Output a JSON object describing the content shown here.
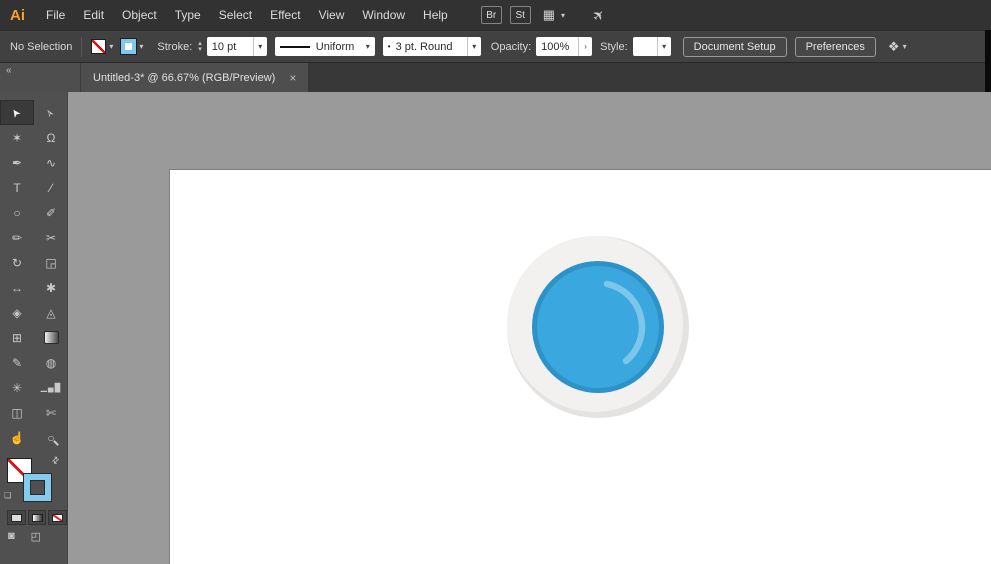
{
  "menubar": {
    "logo": "Ai",
    "items": [
      "File",
      "Edit",
      "Object",
      "Type",
      "Select",
      "Effect",
      "View",
      "Window",
      "Help"
    ],
    "bridge_badge": "Br",
    "stock_badge": "St"
  },
  "controlbar": {
    "selection_status": "No Selection",
    "stroke_label": "Stroke:",
    "stroke_weight": "10 pt",
    "width_profile": "Uniform",
    "brush_bullet": "•",
    "brush_name": "3 pt. Round",
    "opacity_label": "Opacity:",
    "opacity_value": "100%",
    "style_label": "Style:",
    "document_setup_button": "Document Setup",
    "preferences_button": "Preferences"
  },
  "tabbar": {
    "collapse_icon": "«",
    "active_tab_title": "Untitled-3* @ 66.67% (RGB/Preview)",
    "close_icon": "×"
  },
  "icons": {
    "chevron_down": "▾",
    "stepper_up": "▴",
    "stepper_down": "▾",
    "opacity_chevron": "›",
    "workspace_grid": "▦",
    "gpu_performance": "✈",
    "transform_widget": "❖",
    "swap_arrows": "⇄",
    "mini_swatches": "❏",
    "draw_mode_normal": "◙",
    "draw_mode_alt": "◰"
  },
  "tools": {
    "items": [
      {
        "name": "selection-tool",
        "glyph": "➤"
      },
      {
        "name": "direct-selection-tool",
        "glyph": "➢"
      },
      {
        "name": "magic-wand-tool",
        "glyph": "✶"
      },
      {
        "name": "lasso-tool",
        "glyph": "Ω"
      },
      {
        "name": "pen-tool",
        "glyph": "✒"
      },
      {
        "name": "curvature-tool",
        "glyph": "∿"
      },
      {
        "name": "type-tool",
        "glyph": "T"
      },
      {
        "name": "line-segment-tool",
        "glyph": "∕"
      },
      {
        "name": "ellipse-tool",
        "glyph": "○"
      },
      {
        "name": "paintbrush-tool",
        "glyph": "✐"
      },
      {
        "name": "pencil-tool",
        "glyph": "✏"
      },
      {
        "name": "scissors-tool",
        "glyph": "✂"
      },
      {
        "name": "rotate-tool",
        "glyph": "↻"
      },
      {
        "name": "scale-tool",
        "glyph": "◲"
      },
      {
        "name": "width-tool",
        "glyph": "↔"
      },
      {
        "name": "free-transform-tool",
        "glyph": "✱"
      },
      {
        "name": "shape-builder-tool",
        "glyph": "◈"
      },
      {
        "name": "perspective-grid-tool",
        "glyph": "◬"
      },
      {
        "name": "mesh-tool",
        "glyph": "⊞"
      },
      {
        "name": "gradient-tool",
        "glyph": ""
      },
      {
        "name": "eyedropper-tool",
        "glyph": "✎"
      },
      {
        "name": "blend-tool",
        "glyph": "◍"
      },
      {
        "name": "symbol-sprayer-tool",
        "glyph": "✳"
      },
      {
        "name": "column-graph-tool",
        "glyph": "▁▄█"
      },
      {
        "name": "artboard-tool",
        "glyph": "◫"
      },
      {
        "name": "slice-tool",
        "glyph": "✄"
      },
      {
        "name": "hand-tool",
        "glyph": "☝"
      },
      {
        "name": "zoom-tool",
        "glyph": "○"
      }
    ]
  },
  "artwork": {
    "pasteboard_color": "#9a9a9a",
    "artboard_color": "#ffffff",
    "ring_shadow": "#e5e3e1",
    "ring_light": "#f2f1ef",
    "blue_dark": "#2c92c7",
    "blue": "#3aa7de",
    "arc": "#7bc6ea"
  }
}
